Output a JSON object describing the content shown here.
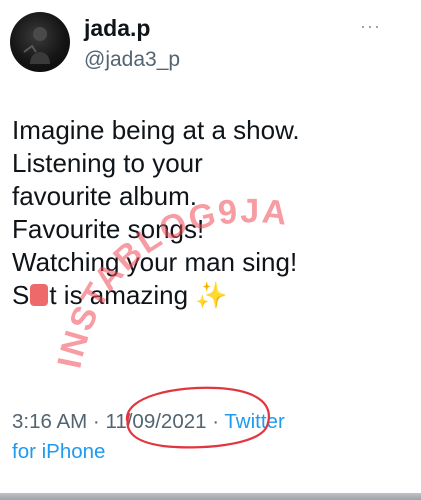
{
  "author": {
    "display_name": "jada.p",
    "handle": "@jada3_p"
  },
  "menu": {
    "more_glyph": "···",
    "icon": "more-dots-icon"
  },
  "tweet": {
    "line1": "Imagine being at a show.",
    "line2": "Listening to your",
    "line3": "favourite album.",
    "line4": "Favourite songs!",
    "line5": "Watching your man sing!",
    "line6_prefix": "S",
    "line6_suffix": "t is amazing",
    "sparkles": "✨"
  },
  "meta": {
    "time": "3:16 AM",
    "separator": "·",
    "date": "11/09/2021",
    "separator2": "·",
    "source_part1": "Twitter",
    "source_part2": "for iPhone"
  },
  "watermark": {
    "text": "INSTABLOG9JA"
  },
  "colors": {
    "text": "#0f1419",
    "secondary": "#536471",
    "link": "#1d9bf0",
    "annotation_red": "#e2363f",
    "watermark_red": "#ee4b55",
    "redaction": "#ee6a6a"
  }
}
